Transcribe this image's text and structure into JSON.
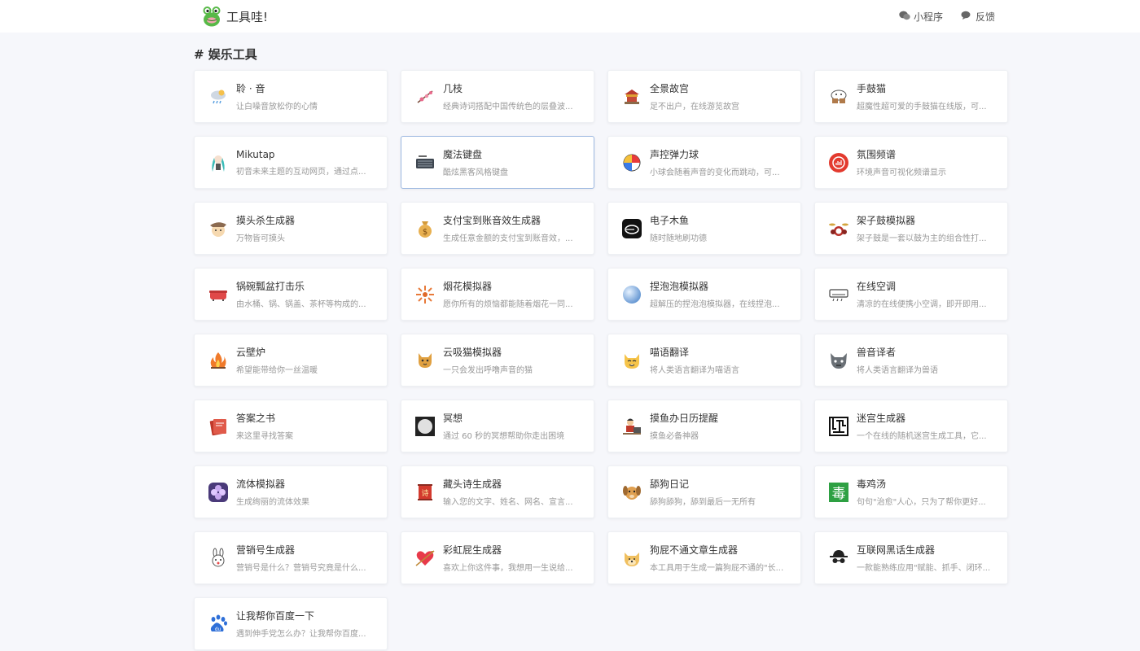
{
  "header": {
    "brand_name": "工具哇!",
    "actions": [
      {
        "label": "小程序",
        "icon": "wechat-icon"
      },
      {
        "label": "反馈",
        "icon": "chat-icon"
      }
    ]
  },
  "section": {
    "title": "# 娱乐工具"
  },
  "tools": [
    {
      "name": "聆 · 音",
      "desc": "让白噪音放松你的心情",
      "icon": "rain-cloud-icon"
    },
    {
      "name": "几枝",
      "desc": "经典诗词搭配中国传统色的层叠波...",
      "icon": "plum-branch-icon"
    },
    {
      "name": "全景故宫",
      "desc": "足不出户，在线游览故宫",
      "icon": "palace-icon"
    },
    {
      "name": "手鼓猫",
      "desc": "超魔性超可爱的手鼓猫在线版，可...",
      "icon": "bongo-cat-icon"
    },
    {
      "name": "Mikutap",
      "desc": "初音未来主题的互动网页，通过点...",
      "icon": "miku-icon"
    },
    {
      "name": "魔法键盘",
      "desc": "酷炫黑客风格键盘",
      "icon": "keyboard-icon"
    },
    {
      "name": "声控弹力球",
      "desc": "小球会随着声音的变化而跳动，可...",
      "icon": "beach-ball-icon"
    },
    {
      "name": "氛围频谱",
      "desc": "环境声音可视化频谱显示",
      "icon": "spectrum-icon"
    },
    {
      "name": "摸头杀生成器",
      "desc": "万物皆可摸头",
      "icon": "pat-head-icon"
    },
    {
      "name": "支付宝到账音效生成器",
      "desc": "生成任意金额的支付宝到账音效，...",
      "icon": "money-bag-icon"
    },
    {
      "name": "电子木鱼",
      "desc": "随时随地刷功德",
      "icon": "wooden-fish-icon"
    },
    {
      "name": "架子鼓模拟器",
      "desc": "架子鼓是一套以鼓为主的组合性打...",
      "icon": "drum-kit-icon"
    },
    {
      "name": "锅碗瓢盆打击乐",
      "desc": "由水桶、锅、锅盖、茶杯等构成的...",
      "icon": "pot-icon"
    },
    {
      "name": "烟花模拟器",
      "desc": "愿你所有的烦恼都能随着烟花一同...",
      "icon": "firework-icon"
    },
    {
      "name": "捏泡泡模拟器",
      "desc": "超解压的捏泡泡模拟器，在线捏泡...",
      "icon": "bubble-icon"
    },
    {
      "name": "在线空调",
      "desc": "清凉的在线便携小空调，即开即用...",
      "icon": "air-conditioner-icon"
    },
    {
      "name": "云壁炉",
      "desc": "希望能带给你一丝温暖",
      "icon": "fireplace-icon"
    },
    {
      "name": "云吸猫模拟器",
      "desc": "一只会发出呼噜声音的猫",
      "icon": "cat-icon"
    },
    {
      "name": "喵语翻译",
      "desc": "将人类语言翻译为喵语言",
      "icon": "cat-face-icon"
    },
    {
      "name": "兽音译者",
      "desc": "将人类语言翻译为兽语",
      "icon": "beast-icon"
    },
    {
      "name": "答案之书",
      "desc": "来这里寻找答案",
      "icon": "book-icon"
    },
    {
      "name": "冥想",
      "desc": "通过 60 秒的冥想帮助你走出困境",
      "icon": "meditation-icon"
    },
    {
      "name": "摸鱼办日历提醒",
      "desc": "摸鱼必备神器",
      "icon": "office-worker-icon"
    },
    {
      "name": "迷宫生成器",
      "desc": "一个在线的随机迷宫生成工具，它...",
      "icon": "maze-icon"
    },
    {
      "name": "流体模拟器",
      "desc": "生成绚丽的流体效果",
      "icon": "fluid-icon"
    },
    {
      "name": "藏头诗生成器",
      "desc": "输入您的文字、姓名、网名、宣言...",
      "icon": "poem-icon"
    },
    {
      "name": "舔狗日记",
      "desc": "舔狗舔狗，舔到最后一无所有",
      "icon": "dog-icon"
    },
    {
      "name": "毒鸡汤",
      "desc": "句句\"治愈\"人心，只为了帮你更好...",
      "icon": "poison-icon"
    },
    {
      "name": "营销号生成器",
      "desc": "营销号是什么？营销号究竟是什么...",
      "icon": "rabbit-icon"
    },
    {
      "name": "彩虹屁生成器",
      "desc": "喜欢上你这件事，我想用一生说给...",
      "icon": "heart-arrow-icon"
    },
    {
      "name": "狗屁不通文章生成器",
      "desc": "本工具用于生成一篇狗屁不通的\"长...",
      "icon": "doge-icon"
    },
    {
      "name": "互联网黑话生成器",
      "desc": "一款能熟练应用\"赋能、抓手、闭环...",
      "icon": "spy-icon"
    },
    {
      "name": "让我帮你百度一下",
      "desc": "遇到伸手党怎么办？让我帮你百度...",
      "icon": "baidu-icon"
    }
  ]
}
